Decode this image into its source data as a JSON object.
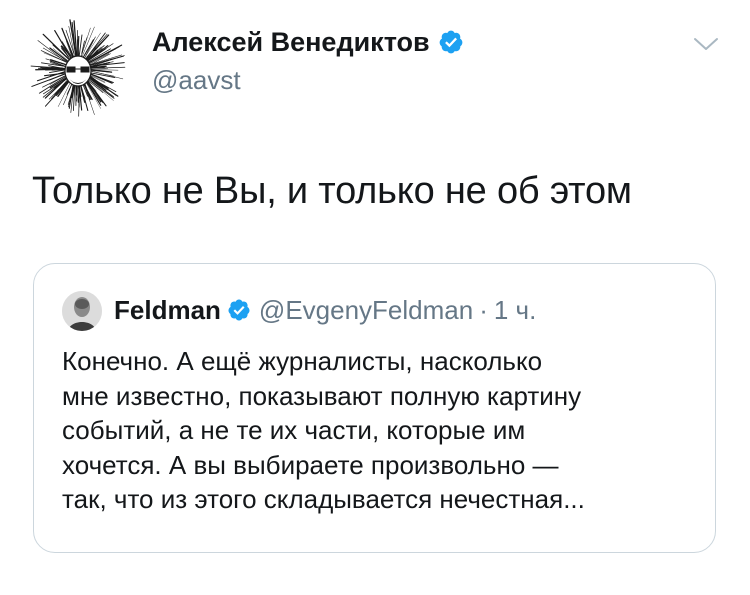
{
  "tweet": {
    "author": {
      "name": "Алексей Венедиктов",
      "handle": "@aavst",
      "verified_icon": "verified-badge-icon",
      "avatar_icon": "avatar-sketch"
    },
    "menu_icon": "chevron-down-icon",
    "text": "Только не Вы, и только не об этом",
    "quoted": {
      "name": "Feldman",
      "handle": "@EvgenyFeldman",
      "separator": "·",
      "time": "1 ч.",
      "body_lines": [
        "Конечно. А ещё журналисты, насколько",
        "мне известно, показывают полную картину",
        "событий, а не те их части, которые им",
        "хочется. А вы выбираете произвольно —",
        "так, что из этого складывается нечестная..."
      ]
    },
    "colors": {
      "verified": "#1da1f2",
      "secondary_text": "#657786",
      "primary_text": "#14171a",
      "border": "#ccd6dd"
    }
  }
}
